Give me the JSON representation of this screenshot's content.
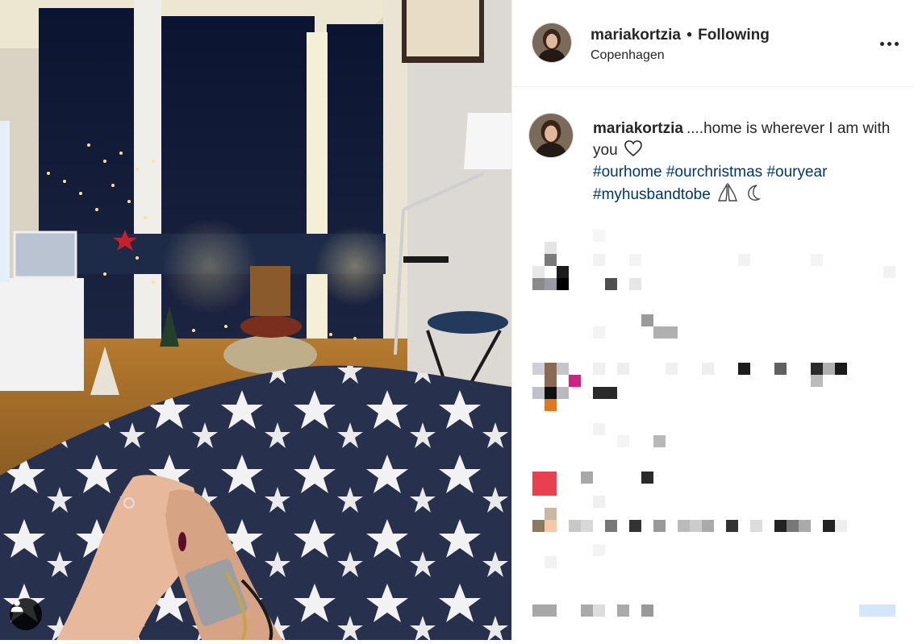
{
  "post": {
    "username": "mariakortzia",
    "separator": "•",
    "follow_status": "Following",
    "location": "Copenhagen"
  },
  "caption": {
    "username": "mariakortzia",
    "text": "....home is wherever I am with you",
    "hashtags": [
      "#ourhome",
      "#ourchristmas",
      "#ouryear",
      "#myhusbandtobe"
    ],
    "trailing_icons": [
      "heart-outline-icon",
      "praying-hands-icon",
      "crescent-moon-icon"
    ]
  },
  "icons": {
    "more_options": "more-options-icon",
    "tag_user": "user-tag-icon"
  },
  "colors": {
    "hashtag": "#00376b",
    "text": "#262626",
    "border": "#efefef"
  }
}
